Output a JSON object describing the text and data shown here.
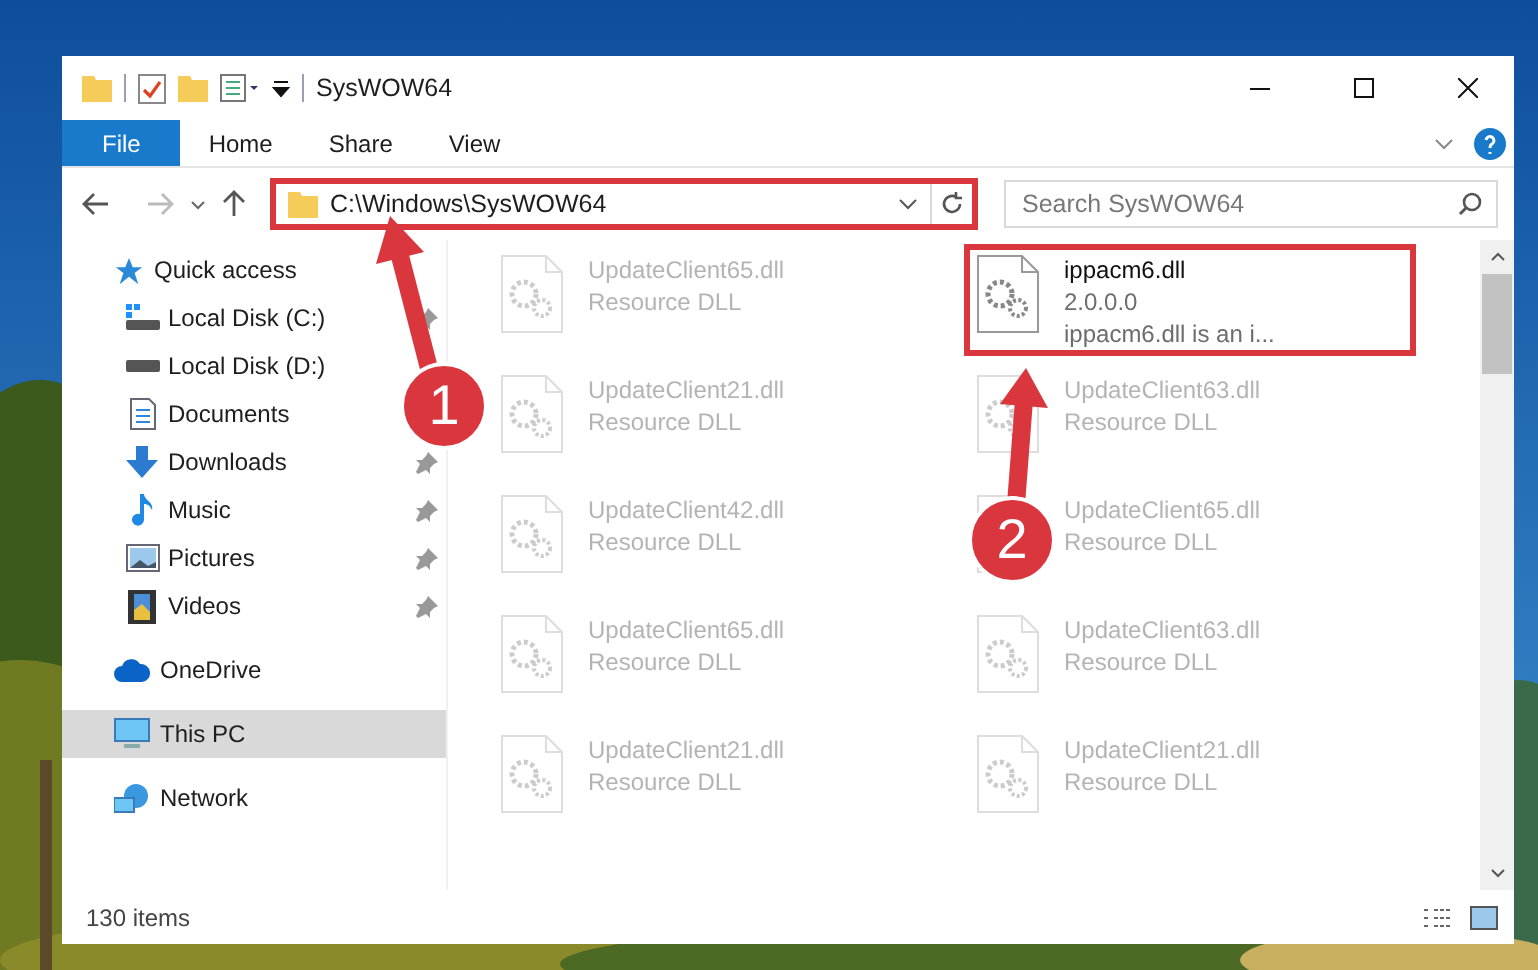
{
  "window": {
    "title": "SysWOW64"
  },
  "ribbon_tabs": [
    {
      "label": "File",
      "selected": true
    },
    {
      "label": "Home",
      "selected": false
    },
    {
      "label": "Share",
      "selected": false
    },
    {
      "label": "View",
      "selected": false
    }
  ],
  "address": {
    "path": "C:\\Windows\\SysWOW64",
    "highlighted": true
  },
  "search": {
    "placeholder": "Search SysWOW64"
  },
  "sidebar": {
    "items": [
      {
        "label": "Quick access",
        "kind": "star",
        "selected": false,
        "children": [
          {
            "label": "Local Disk (C:)",
            "kind": "drive-c",
            "pinned": true
          },
          {
            "label": "Local Disk (D:)",
            "kind": "drive"
          },
          {
            "label": "Documents",
            "kind": "documents"
          },
          {
            "label": "Downloads",
            "kind": "downloads",
            "pinned": true
          },
          {
            "label": "Music",
            "kind": "music",
            "pinned": true
          },
          {
            "label": "Pictures",
            "kind": "pictures",
            "pinned": true
          },
          {
            "label": "Videos",
            "kind": "videos",
            "pinned": true
          }
        ]
      },
      {
        "label": "OneDrive",
        "kind": "cloud",
        "selected": false
      },
      {
        "label": "This PC",
        "kind": "pc",
        "selected": true
      },
      {
        "label": "Network",
        "kind": "network",
        "selected": false
      }
    ]
  },
  "files": [
    {
      "name": "UpdateClient65.dll",
      "lines": [
        "Resource DLL"
      ],
      "faded": true,
      "highlighted": false
    },
    {
      "name": "ippacm6.dll",
      "lines": [
        "2.0.0.0",
        "ippacm6.dll is an i..."
      ],
      "faded": false,
      "highlighted": true
    },
    {
      "name": "UpdateClient21.dll",
      "lines": [
        "Resource DLL"
      ],
      "faded": true,
      "highlighted": false
    },
    {
      "name": "UpdateClient63.dll",
      "lines": [
        "Resource DLL"
      ],
      "faded": true,
      "highlighted": false
    },
    {
      "name": "UpdateClient42.dll",
      "lines": [
        "Resource DLL"
      ],
      "faded": true,
      "highlighted": false
    },
    {
      "name": "UpdateClient65.dll",
      "lines": [
        "Resource DLL"
      ],
      "faded": true,
      "highlighted": false
    },
    {
      "name": "UpdateClient65.dll",
      "lines": [
        "Resource DLL"
      ],
      "faded": true,
      "highlighted": false
    },
    {
      "name": "UpdateClient63.dll",
      "lines": [
        "Resource DLL"
      ],
      "faded": true,
      "highlighted": false
    },
    {
      "name": "UpdateClient21.dll",
      "lines": [
        "Resource DLL"
      ],
      "faded": true,
      "highlighted": false
    },
    {
      "name": "UpdateClient21.dll",
      "lines": [
        "Resource DLL"
      ],
      "faded": true,
      "highlighted": false
    }
  ],
  "status_bar": {
    "count": "130 items"
  },
  "callouts": [
    {
      "number": "1"
    },
    {
      "number": "2"
    }
  ]
}
